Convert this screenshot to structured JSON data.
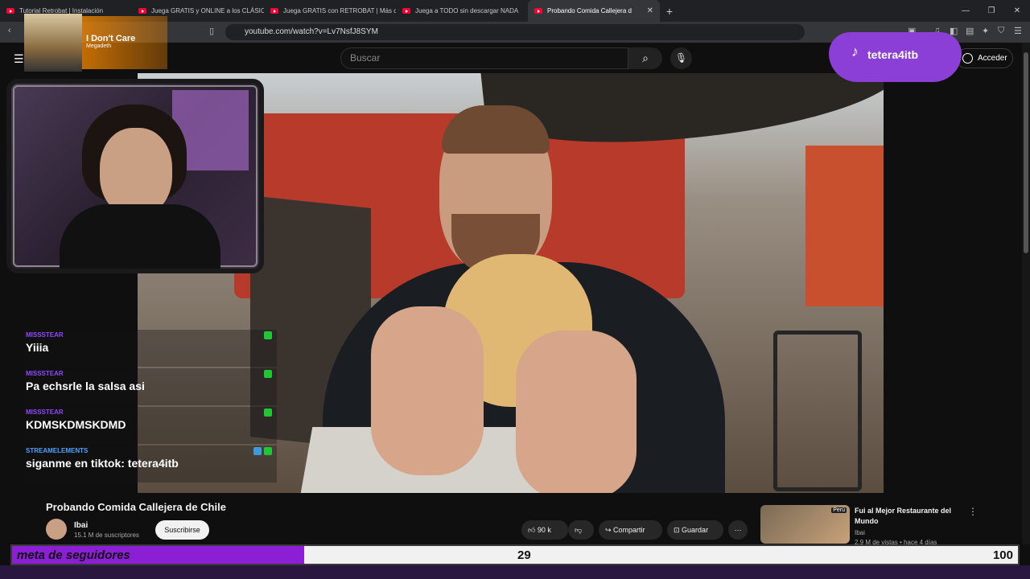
{
  "browser": {
    "tabs": [
      {
        "label": "Tutorial Retrobat | Instalación"
      },
      {
        "label": "Juega GRATIS y ONLINE a los CLÁSIC"
      },
      {
        "label": "Juega GRATIS con RETROBAT | Más d"
      },
      {
        "label": "Juega a TODO sin descargar NADA"
      },
      {
        "label": "Probando Comida Callejera d"
      }
    ],
    "url": "youtube.com/watch?v=Lv7NsfJ8SYM"
  },
  "youtube": {
    "search_placeholder": "Buscar",
    "sign_in": "Acceder",
    "video_title": "Probando Comida Callejera de Chile",
    "channel": "Ibai",
    "subscribers": "15.1 M de suscriptores",
    "subscribe": "Suscribirse",
    "likes": "90 k",
    "share": "Compartir",
    "save": "Guardar",
    "recommended": {
      "title": "Fui al Mejor Restaurante del Mundo",
      "channel": "Ibai",
      "meta": "2,9 M de vistas • hace 4 días",
      "flag": "Perú"
    }
  },
  "overlay": {
    "now_playing": {
      "title": "I Don't Care",
      "artist": "Megadeth"
    },
    "tiktok_handle": "tetera4itb",
    "chat": [
      {
        "user": "MISSSTEAR",
        "message": "Yiiia"
      },
      {
        "user": "MISSSTEAR",
        "message": "Pa echsrle la salsa asi"
      },
      {
        "user": "MISSSTEAR",
        "message": "KDMSKDMSKDMD"
      },
      {
        "user": "STREAMELEMENTS",
        "message": "siganme en tiktok: tetera4itb"
      }
    ],
    "goal": {
      "label": "meta de seguidores",
      "current": "29",
      "target": "100",
      "progress": 0.29
    }
  }
}
